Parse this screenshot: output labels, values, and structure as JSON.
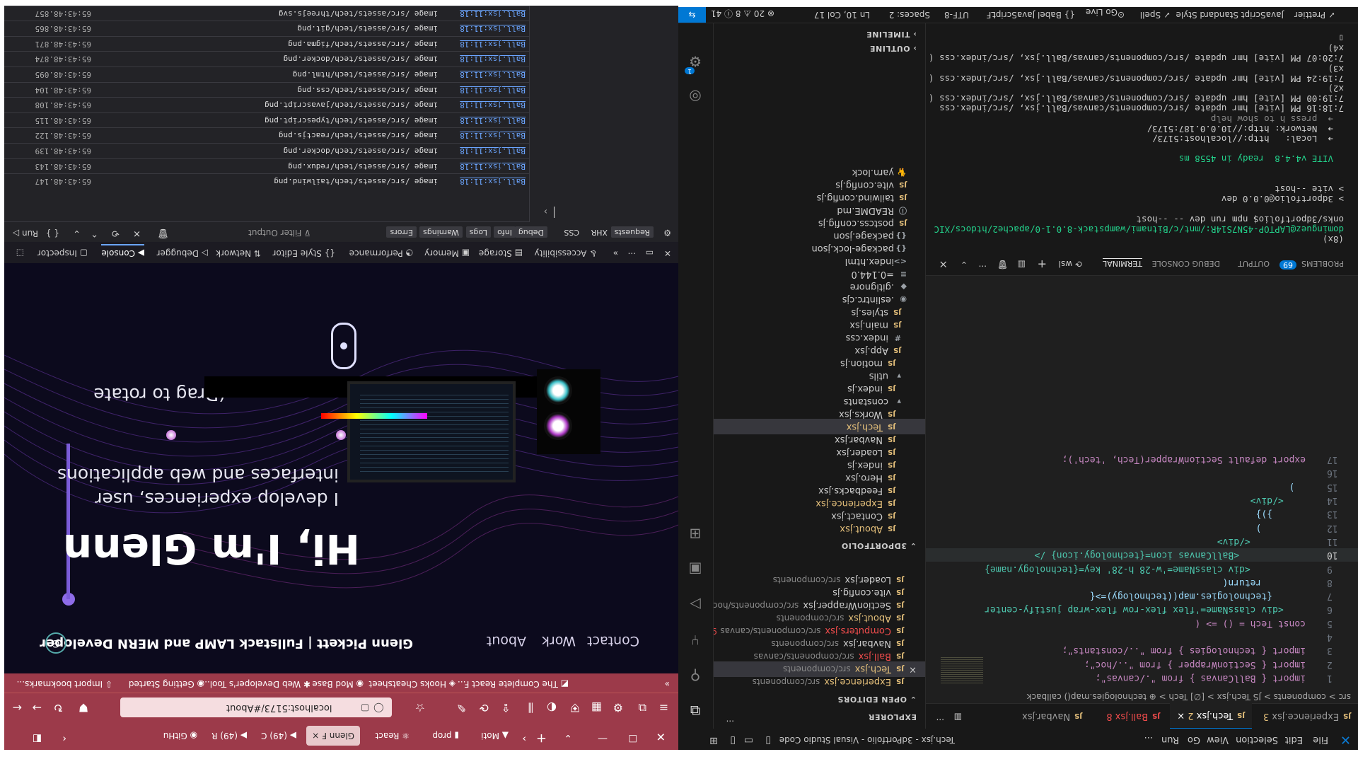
{
  "vscode": {
    "menu": [
      "File",
      "Edit",
      "Selection",
      "View",
      "Go",
      "Run",
      "..."
    ],
    "window_title": "Tech.jsx - 3dPortfolio - Visual Studio Code",
    "activity_badge": "1",
    "sidebar": {
      "explorer_title": "EXPLORER",
      "open_editors_title": "OPEN EDITORS",
      "open_editors": [
        {
          "name": "Experience.jsx",
          "path": "src/components",
          "badge": "3",
          "color": "#e5c07b"
        },
        {
          "name": "Tech.jsx",
          "path": "src/components",
          "badge": "2",
          "color": "#e5c07b",
          "close": "×"
        },
        {
          "name": "Ball.jsx",
          "path": "src/components/canvas",
          "badge": "8",
          "color": "#f14c4c"
        },
        {
          "name": "Navbar.jsx",
          "path": "src/components",
          "badge": "",
          "color": "#ccc"
        },
        {
          "name": "Computers.jsx",
          "path": "src/components/canvas",
          "badge": "9+",
          "color": "#f14c4c"
        },
        {
          "name": "About.jsx",
          "path": "src/components",
          "badge": "3",
          "color": "#e5c07b"
        },
        {
          "name": "SectionWrapper.jsx",
          "path": "src/components/hoc",
          "badge": "",
          "color": "#ccc"
        },
        {
          "name": "vite.config.js",
          "path": "",
          "badge": "",
          "color": "#ccc"
        },
        {
          "name": "Loader.jsx",
          "path": "src/components",
          "badge": "",
          "color": "#ccc"
        }
      ],
      "project_title": "3DPORTFOLIO",
      "tree": [
        {
          "name": "About.jsx",
          "badge": "3",
          "color": "#e5c07b",
          "icon": "JS",
          "indent": 1
        },
        {
          "name": "Contact.jsx",
          "badge": "",
          "color": "#ccc",
          "icon": "JS",
          "indent": 1
        },
        {
          "name": "Experience.jsx",
          "badge": "3",
          "color": "#e5c07b",
          "icon": "JS",
          "indent": 1
        },
        {
          "name": "Feedbacks.jsx",
          "badge": "",
          "color": "#ccc",
          "icon": "JS",
          "indent": 1
        },
        {
          "name": "Hero.jsx",
          "badge": "",
          "color": "#ccc",
          "icon": "JS",
          "indent": 1
        },
        {
          "name": "index.js",
          "badge": "",
          "color": "#ccc",
          "icon": "JS",
          "indent": 1
        },
        {
          "name": "Loader.jsx",
          "badge": "",
          "color": "#ccc",
          "icon": "JS",
          "indent": 1
        },
        {
          "name": "Navbar.jsx",
          "badge": "",
          "color": "#ccc",
          "icon": "JS",
          "indent": 1
        },
        {
          "name": "Tech.jsx",
          "badge": "2",
          "color": "#e5c07b",
          "icon": "JS",
          "indent": 1,
          "selected": true
        },
        {
          "name": "Works.jsx",
          "badge": "",
          "color": "#ccc",
          "icon": "JS",
          "indent": 1
        },
        {
          "name": "constants",
          "badge": "",
          "color": "#ccc",
          "icon": "▾",
          "indent": 0
        },
        {
          "name": "index.js",
          "badge": "",
          "color": "#ccc",
          "icon": "JS",
          "indent": 1
        },
        {
          "name": "utils",
          "badge": "",
          "color": "#ccc",
          "icon": "▾",
          "indent": 0
        },
        {
          "name": "motion.js",
          "badge": "",
          "color": "#ccc",
          "icon": "JS",
          "indent": 1
        },
        {
          "name": "App.jsx",
          "badge": "",
          "color": "#ccc",
          "icon": "JS",
          "indent": 0
        },
        {
          "name": "index.css",
          "badge": "",
          "color": "#ccc",
          "icon": "#",
          "indent": 0
        },
        {
          "name": "main.jsx",
          "badge": "",
          "color": "#ccc",
          "icon": "JS",
          "indent": 0
        },
        {
          "name": "styles.js",
          "badge": "",
          "color": "#ccc",
          "icon": "JS",
          "indent": 0
        },
        {
          "name": ".eslintrc.cjs",
          "badge": "",
          "color": "#ccc",
          "icon": "◉",
          "indent": -1
        },
        {
          "name": ".gitignore",
          "badge": "",
          "color": "#ccc",
          "icon": "◆",
          "indent": -1
        },
        {
          "name": "=0.144.0",
          "badge": "",
          "color": "#ccc",
          "icon": "≡",
          "indent": -1
        },
        {
          "name": "index.html",
          "badge": "",
          "color": "#ccc",
          "icon": "<>",
          "indent": -1
        },
        {
          "name": "package-lock.json",
          "badge": "",
          "color": "#ccc",
          "icon": "{}",
          "indent": -1
        },
        {
          "name": "package.json",
          "badge": "",
          "color": "#ccc",
          "icon": "{}",
          "indent": -1
        },
        {
          "name": "postcss.config.js",
          "badge": "",
          "color": "#ccc",
          "icon": "JS",
          "indent": -1
        },
        {
          "name": "README.md",
          "badge": "",
          "color": "#ccc",
          "icon": "ⓘ",
          "indent": -1
        },
        {
          "name": "tailwind.config.js",
          "badge": "",
          "color": "#ccc",
          "icon": "JS",
          "indent": -1
        },
        {
          "name": "vite.config.js",
          "badge": "",
          "color": "#ccc",
          "icon": "JS",
          "indent": -1
        },
        {
          "name": "yarn.lock",
          "badge": "",
          "color": "#ccc",
          "icon": "🐈",
          "indent": -1
        }
      ],
      "outline_title": "OUTLINE",
      "timeline_title": "TIMELINE"
    },
    "tabs": [
      {
        "label": "Experience.jsx",
        "badge": "3"
      },
      {
        "label": "Tech.jsx",
        "badge": "2",
        "active": true
      },
      {
        "label": "Ball.jsx",
        "badge": "8"
      },
      {
        "label": "Navbar.jsx",
        "badge": ""
      }
    ],
    "breadcrumb": "src > components > JS Tech.jsx > [∅] Tech > ⊕ technologies.map() callback",
    "code_lines": [
      {
        "n": "1",
        "text": "import { BallCanvas } from \"./canvas\";"
      },
      {
        "n": "2",
        "text": "import { SectionWrapper } from \"../hoc\";"
      },
      {
        "n": "3",
        "text": "import { technologies } from \"../constants\";"
      },
      {
        "n": "4",
        "text": ""
      },
      {
        "n": "5",
        "text": "const Tech = () => ("
      },
      {
        "n": "6",
        "text": "    <div className='flex flex-row flex-wrap justify-center"
      },
      {
        "n": "7",
        "text": "      {technologies.map((technology)=>{"
      },
      {
        "n": "8",
        "text": "        return("
      },
      {
        "n": "9",
        "text": "          <div className='w-28 h-28' key={technology.name}"
      },
      {
        "n": "10",
        "text": "            <BallCanvas icon={technology.icon} />"
      },
      {
        "n": "11",
        "text": "          </div>"
      },
      {
        "n": "12",
        "text": "        )"
      },
      {
        "n": "13",
        "text": "      })}"
      },
      {
        "n": "14",
        "text": "    </div>"
      },
      {
        "n": "15",
        "text": "  )"
      },
      {
        "n": "16",
        "text": ""
      },
      {
        "n": "17",
        "text": "export default SectionWrapper(Tech, 'tech');"
      }
    ],
    "panel_tabs": [
      "PROBLEMS",
      "OUTPUT",
      "DEBUG CONSOLE",
      "TERMINAL"
    ],
    "problems_count": "69",
    "terminal_shell": "wsl",
    "terminal_lines": [
      {
        "text": "(8x)",
        "color": "#ccc"
      },
      {
        "text": "dominguez@LAPTOP-45N7S14R:/mnt/c/Bitnami/wampstack-8.0.1-0/apache2/htdocs/XIC",
        "color": "#23d18b"
      },
      {
        "text": "onks/3dportfolio$ npm run dev -- --host",
        "color": "#ccc"
      },
      {
        "text": "",
        "color": "#ccc"
      },
      {
        "text": "> 3dportfolio@0.0.0 dev",
        "color": "#ccc"
      },
      {
        "text": "> vite --host",
        "color": "#ccc"
      },
      {
        "text": "",
        "color": "#ccc"
      },
      {
        "text": "",
        "color": "#ccc"
      },
      {
        "text": "  VITE v4.4.8  ready in 4558 ms",
        "color": "#23d18b"
      },
      {
        "text": "",
        "color": "#ccc"
      },
      {
        "text": "  ➜  Local:   http://localhost:5173/",
        "color": "#ccc"
      },
      {
        "text": "  ➜  Network: http://10.0.0.187:5173/",
        "color": "#ccc"
      },
      {
        "text": "  ➜  press h to show help",
        "color": "#8a8a8a"
      },
      {
        "text": "7:18:16 PM [vite] hmr update /src/components/canvas/Ball.jsx, /src/index.css",
        "color": "#ccc"
      },
      {
        "text": "7:19:00 PM [vite] hmr update /src/components/canvas/Ball.jsx, /src/index.css (",
        "color": "#ccc"
      },
      {
        "text": "x2)",
        "color": "#ccc"
      },
      {
        "text": "7:19:24 PM [vite] hmr update /src/components/canvas/Ball.jsx, /src/index.css (",
        "color": "#ccc"
      },
      {
        "text": "x3)",
        "color": "#ccc"
      },
      {
        "text": "7:20:07 PM [vite] hmr update /src/components/canvas/Ball.jsx, /src/index.css (",
        "color": "#ccc"
      },
      {
        "text": "x4)",
        "color": "#ccc"
      },
      {
        "text": "▯",
        "color": "#ccc"
      }
    ],
    "status": {
      "errors": "⊗ 20 ⚠ 8 ⓘ 41",
      "position": "Ln 10, Col 17",
      "spaces": "Spaces: 2",
      "encoding": "UTF-8",
      "eol": "LF",
      "language": "{} Babel JavaScript",
      "golive": "Go Live",
      "spell": "✓ Spell",
      "style": "JavaScript Standard Style",
      "prettier": "✓ Prettier"
    }
  },
  "firefox": {
    "tabs": [
      {
        "label": "GitHu"
      },
      {
        "label": "(49) R"
      },
      {
        "label": "(49) C"
      },
      {
        "label": "Glenn F",
        "active": true
      },
      {
        "label": "React"
      },
      {
        "label": "prop"
      },
      {
        "label": "Moti"
      }
    ],
    "url": "localhost:5173/#About",
    "bookmarks": [
      "Import bookmarks...",
      "Getting Started",
      "Web Developer's Tool...",
      "Mod Base",
      "Hooks Cheatsheet",
      "The Complete React F..."
    ],
    "site": {
      "brand": "Glenn Pickett | Fullstack LAMP and MERN Developer",
      "nav": [
        "About",
        "Work",
        "Contact"
      ],
      "hero_title": "Hi, I'm Glenn",
      "hero_sub": "I develop experiences, user interfaces and web applications",
      "drag_hint": "(Drag to rotate"
    },
    "devtools": {
      "tabs": [
        "Inspector",
        "Console",
        "Debugger",
        "Network",
        "Style Editor",
        "Performance",
        "Memory",
        "Storage",
        "Accessibility"
      ],
      "filter_placeholder": "Filter Output",
      "filter_buttons": [
        "Errors",
        "Warnings",
        "Logs",
        "Info",
        "Debug",
        "CSS",
        "XHR",
        "Requests"
      ],
      "run_label": "Run",
      "log_rows": [
        {
          "src": "Ball.jsx:11:18",
          "msg": "image /src/assets/tech/threejs.svg",
          "ts": "65:43:48.857"
        },
        {
          "src": "Ball.jsx:11:18",
          "msg": "image /src/assets/tech/git.png",
          "ts": "65:43:48.865"
        },
        {
          "src": "Ball.jsx:11:18",
          "msg": "image /src/assets/tech/figma.png",
          "ts": "65:43:48.871"
        },
        {
          "src": "Ball.jsx:11:18",
          "msg": "image /src/assets/tech/docker.png",
          "ts": "65:43:48.874"
        },
        {
          "src": "Ball.jsx:11:18",
          "msg": "image /src/assets/tech/html.png",
          "ts": "65:43:48.095"
        },
        {
          "src": "Ball.jsx:11:18",
          "msg": "image /src/assets/tech/css.png",
          "ts": "65:43:48.104"
        },
        {
          "src": "Ball.jsx:11:18",
          "msg": "image /src/assets/tech/javascript.png",
          "ts": "65:43:48.108"
        },
        {
          "src": "Ball.jsx:11:18",
          "msg": "image /src/assets/tech/typescript.png",
          "ts": "65:43:48.115"
        },
        {
          "src": "Ball.jsx:11:18",
          "msg": "image /src/assets/tech/reactjs.png",
          "ts": "65:43:48.122"
        },
        {
          "src": "Ball.jsx:11:18",
          "msg": "image /src/assets/tech/docker.png",
          "ts": "65:43:48.139"
        },
        {
          "src": "Ball.jsx:11:18",
          "msg": "image /src/assets/tech/redux.png",
          "ts": "65:43:48.143"
        },
        {
          "src": "Ball.jsx:11:18",
          "msg": "image /src/assets/tech/tailwind.png",
          "ts": "65:43:48.147"
        }
      ]
    }
  }
}
